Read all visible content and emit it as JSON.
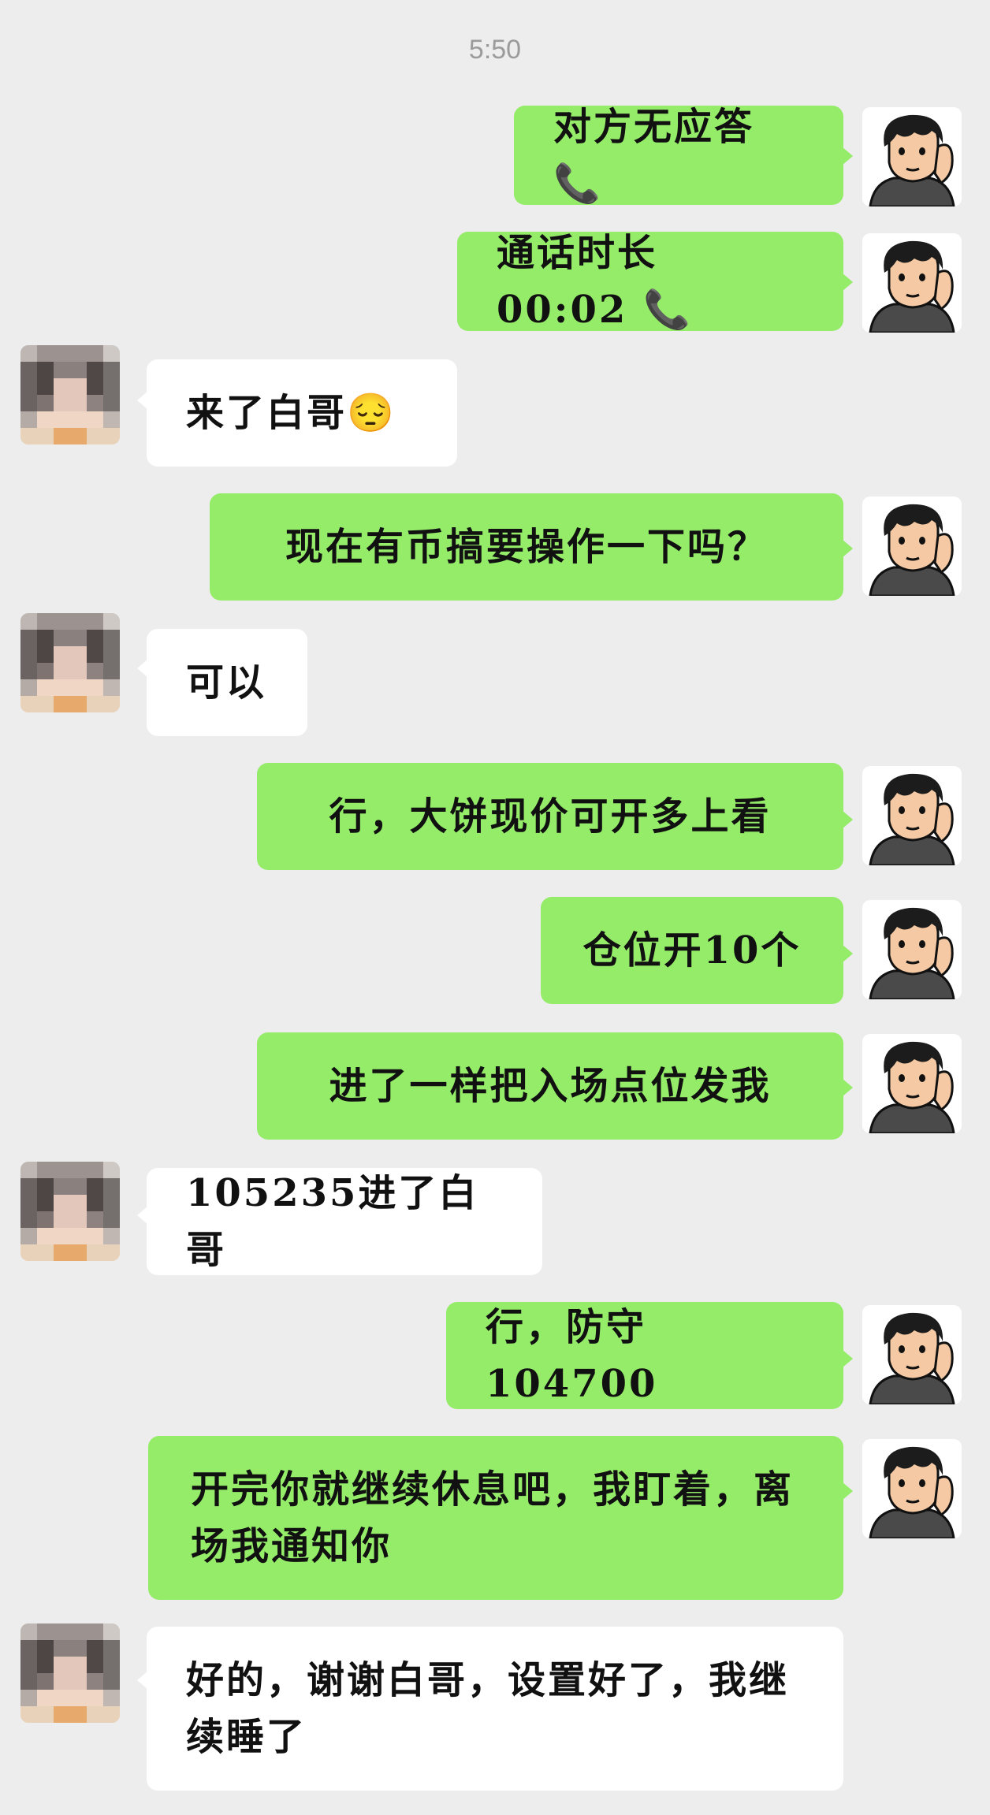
{
  "status": {
    "time": "5:50"
  },
  "colors": {
    "background": "#ededed",
    "my_bubble": "#95ec69",
    "their_bubble": "#ffffff"
  },
  "avatars": {
    "me": "cartoon-boy-avatar",
    "contact": "pixelated-contact-avatar"
  },
  "messages": [
    {
      "from": "me",
      "text": "对方无应答 📞"
    },
    {
      "from": "me",
      "text": "通话时长 00:02 📞"
    },
    {
      "from": "contact",
      "text": "来了白哥😔"
    },
    {
      "from": "me",
      "text": "现在有币搞要操作一下吗？"
    },
    {
      "from": "contact",
      "text": "可以"
    },
    {
      "from": "me",
      "text": "行，大饼现价可开多上看"
    },
    {
      "from": "me",
      "text": "仓位开10个"
    },
    {
      "from": "me",
      "text": "进了一样把入场点位发我"
    },
    {
      "from": "contact",
      "text": "105235进了白哥"
    },
    {
      "from": "me",
      "text": "行，防守104700"
    },
    {
      "from": "me",
      "text": "开完你就继续休息吧，我盯着，离场我通知你"
    },
    {
      "from": "contact",
      "text": "好的，谢谢白哥，设置好了，我继续睡了"
    }
  ]
}
